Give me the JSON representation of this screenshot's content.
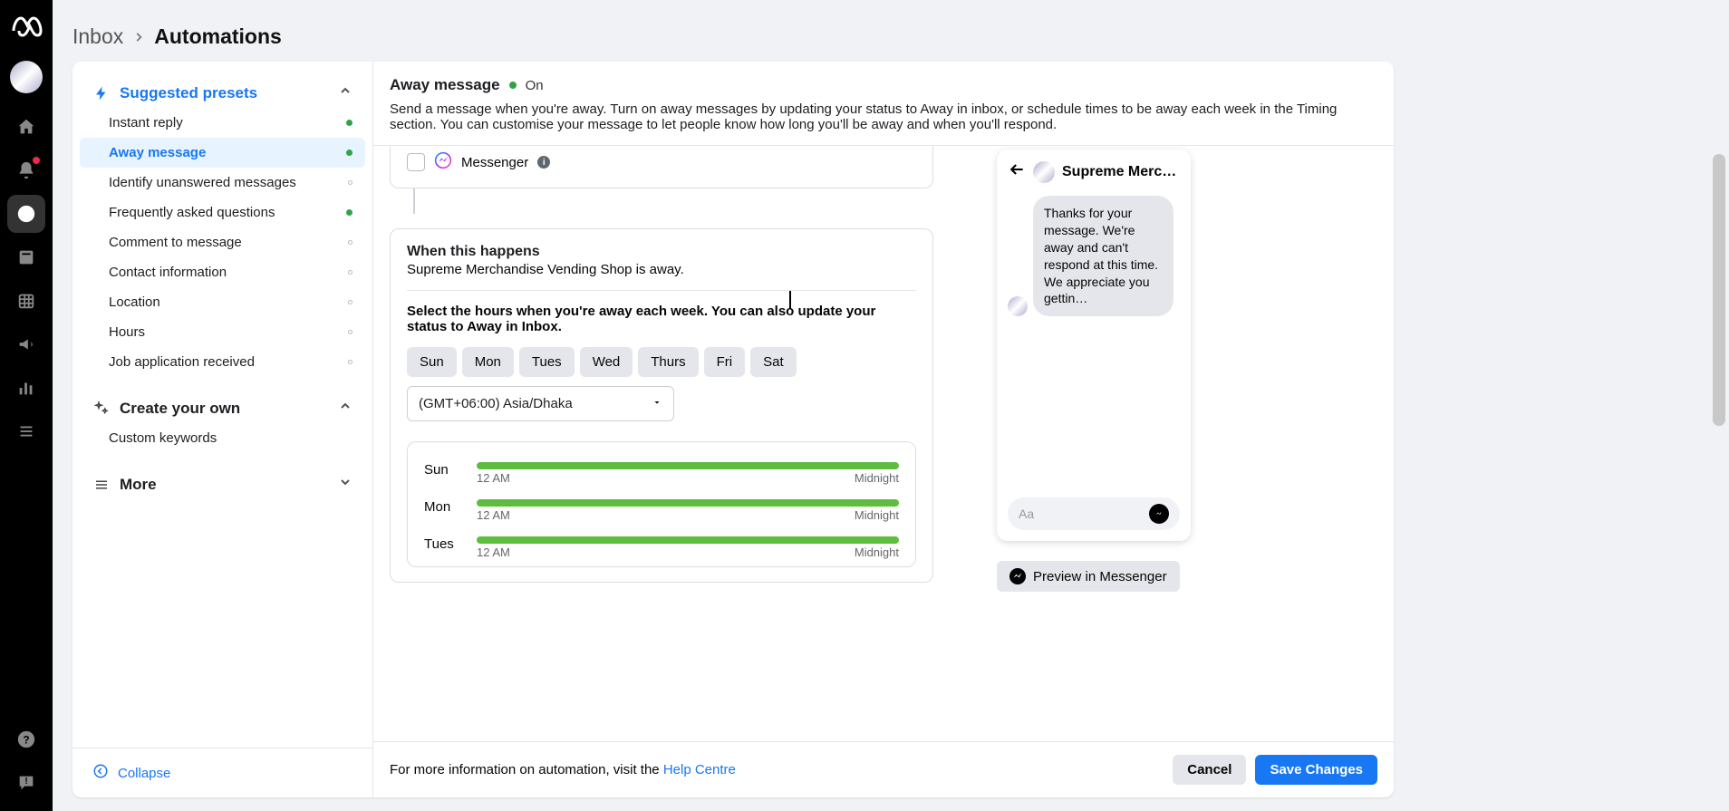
{
  "breadcrumb": {
    "inbox": "Inbox",
    "automations": "Automations"
  },
  "sidebar": {
    "suggested_header": "Suggested presets",
    "items": [
      {
        "label": "Instant reply",
        "status": "green"
      },
      {
        "label": "Away message",
        "status": "green",
        "active": true
      },
      {
        "label": "Identify unanswered messages",
        "status": "grey"
      },
      {
        "label": "Frequently asked questions",
        "status": "green"
      },
      {
        "label": "Comment to message",
        "status": "grey"
      },
      {
        "label": "Contact information",
        "status": "grey"
      },
      {
        "label": "Location",
        "status": "grey"
      },
      {
        "label": "Hours",
        "status": "grey"
      },
      {
        "label": "Job application received",
        "status": "grey"
      }
    ],
    "create_header": "Create your own",
    "create_items": [
      {
        "label": "Custom keywords"
      }
    ],
    "more_header": "More",
    "collapse": "Collapse"
  },
  "header": {
    "title": "Away message",
    "status": "On",
    "desc": "Send a message when you're away. Turn on away messages by updating your status to Away in inbox, or schedule times to be away each week in the Timing section. You can customise your message to let people know how long you'll be away and when you'll respond."
  },
  "channels": {
    "messenger": "Messenger"
  },
  "when": {
    "title": "When this happens",
    "sub": "Supreme Merchandise Vending Shop is away.",
    "instruct": "Select the hours when you're away each week. You can also update your status to Away in Inbox.",
    "days": [
      "Sun",
      "Mon",
      "Tues",
      "Wed",
      "Thurs",
      "Fri",
      "Sat"
    ],
    "timezone": "(GMT+06:00) Asia/Dhaka",
    "schedule": [
      {
        "day": "Sun",
        "start": "12 AM",
        "end": "Midnight"
      },
      {
        "day": "Mon",
        "start": "12 AM",
        "end": "Midnight"
      },
      {
        "day": "Tues",
        "start": "12 AM",
        "end": "Midnight"
      }
    ]
  },
  "preview": {
    "page_name": "Supreme Merc…",
    "bubble": "Thanks for your message. We're away and can't respond at this time. We appreciate you gettin…",
    "input_ph": "Aa",
    "button": "Preview in Messenger"
  },
  "footer": {
    "text": "For more information on automation, visit the ",
    "link": "Help Centre",
    "cancel": "Cancel",
    "save": "Save Changes"
  }
}
